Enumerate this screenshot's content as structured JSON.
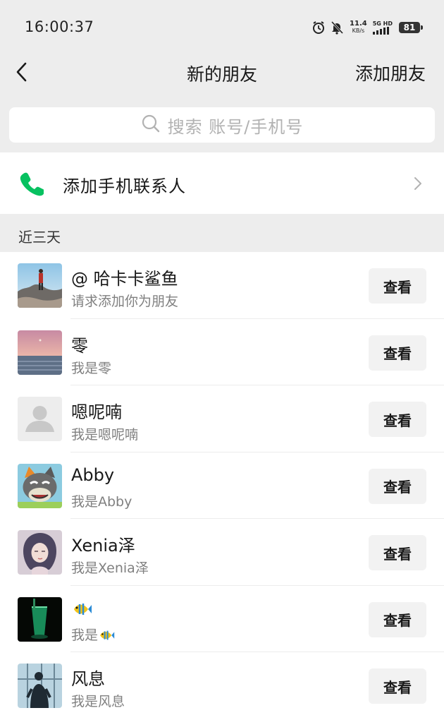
{
  "status_bar": {
    "time": "16:00:37",
    "net_speed_value": "11.4",
    "net_speed_unit": "KB/s",
    "signal_label": "5G HD",
    "battery": "81"
  },
  "nav": {
    "title": "新的朋友",
    "action": "添加朋友"
  },
  "search": {
    "placeholder": "搜索 账号/手机号"
  },
  "phone_contacts": {
    "label": "添加手机联系人"
  },
  "section": {
    "title": "近三天"
  },
  "friends": [
    {
      "name": "@ 哈卡卡鲨鱼",
      "message": "请求添加你为朋友",
      "button": "查看",
      "avatar": "mountain-hiker-avatar"
    },
    {
      "name": "零",
      "message": "我是零",
      "button": "查看",
      "avatar": "sunset-sea-avatar"
    },
    {
      "name": "嗯呢喃",
      "message": "我是嗯呢喃",
      "button": "查看",
      "avatar": "default-person-avatar"
    },
    {
      "name": "Abby",
      "message": "我是Abby",
      "button": "查看",
      "avatar": "cartoon-wolf-avatar"
    },
    {
      "name": "Xenia泽",
      "message": "我是Xenia泽",
      "button": "查看",
      "avatar": "illustrated-girl-avatar"
    },
    {
      "name": "",
      "message": "我是",
      "button": "查看",
      "avatar": "green-glass-avatar",
      "emoji": "fish-icon"
    },
    {
      "name": "风息",
      "message": "我是风息",
      "button": "查看",
      "avatar": "man-window-avatar"
    }
  ],
  "colors": {
    "background": "#ededed",
    "phone_icon": "#07c160",
    "button_bg": "#f2f2f2"
  }
}
